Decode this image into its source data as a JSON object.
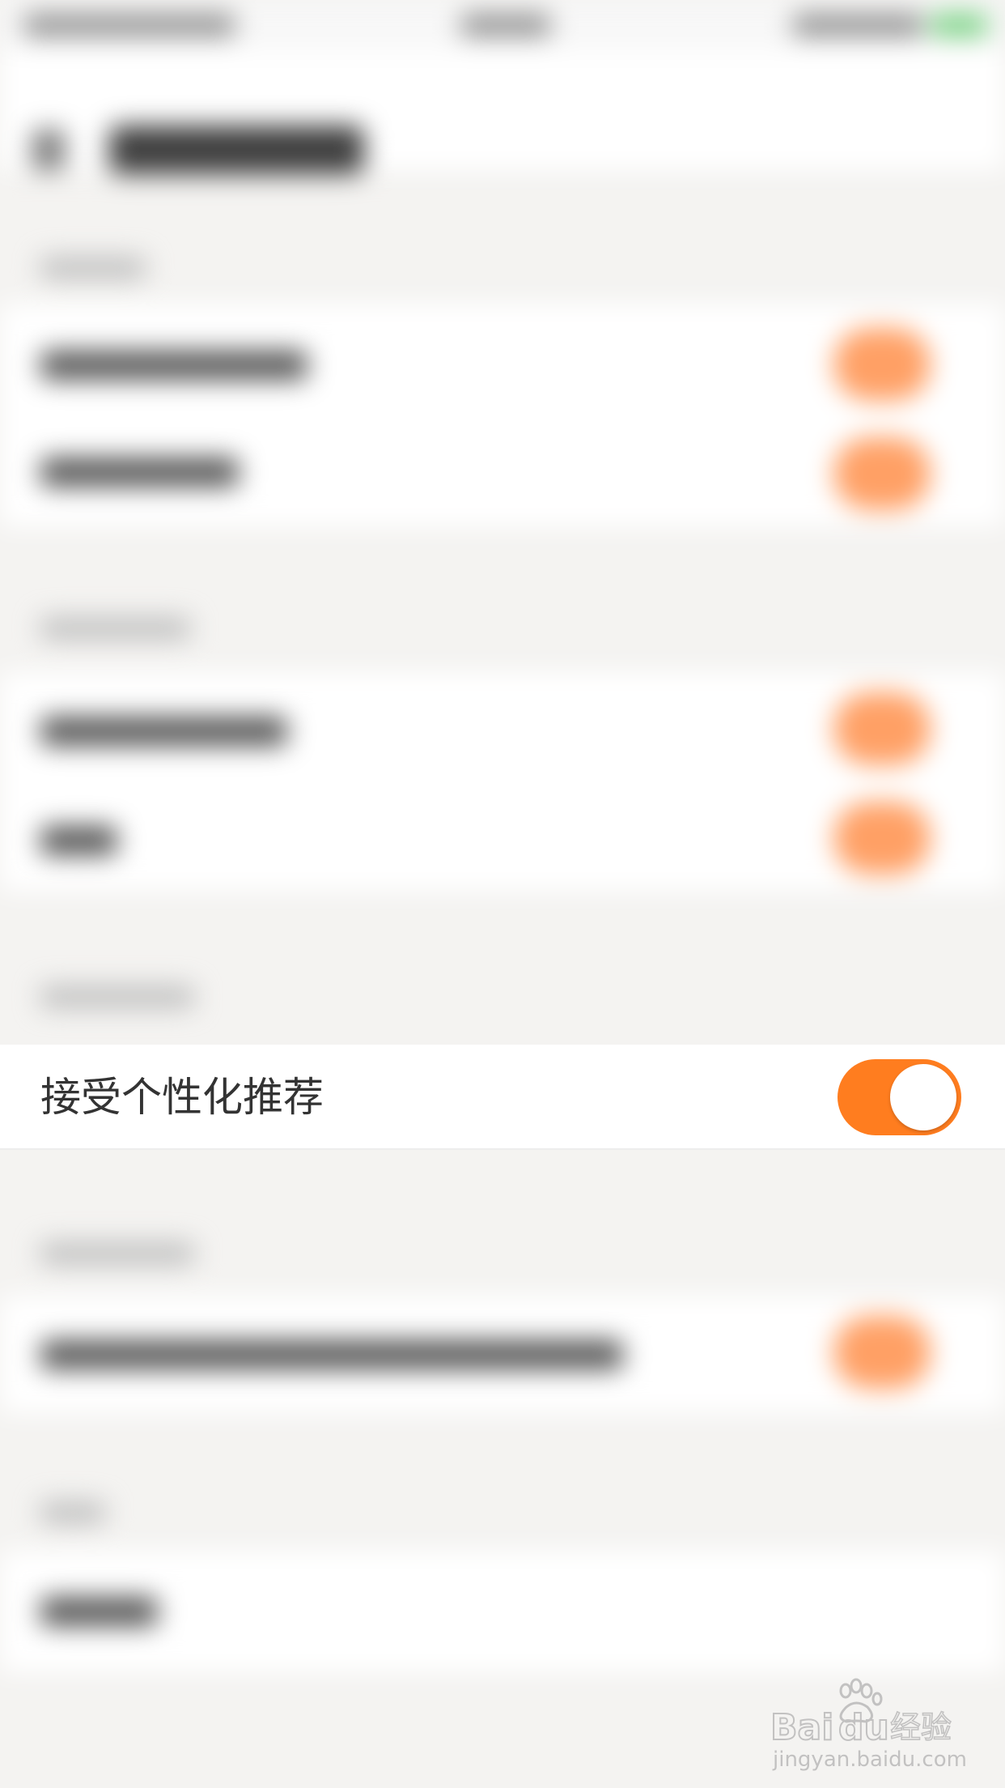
{
  "setting": {
    "label": "接受个性化推荐",
    "enabled": true
  },
  "colors": {
    "accent": "#ff7d1f",
    "page_background": "#f4f3f1",
    "row_background": "#ffffff",
    "label_text": "#333333"
  },
  "watermark": {
    "brand": "Baidu经验",
    "url": "jingyan.baidu.com"
  }
}
